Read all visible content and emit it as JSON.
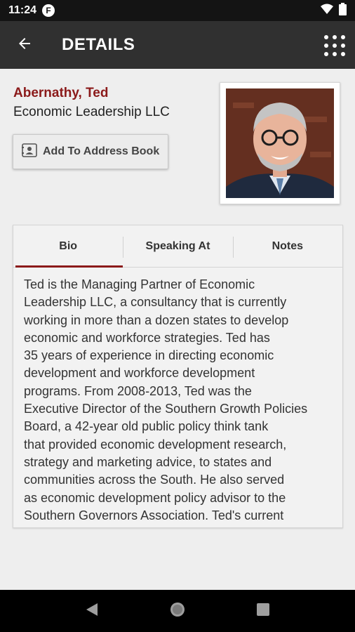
{
  "status_bar": {
    "time": "11:24",
    "badge": "F",
    "icons": [
      "wifi-icon",
      "battery-icon"
    ]
  },
  "app_bar": {
    "back_icon": "arrow-left-icon",
    "title": "DETAILS",
    "menu_icon": "grid-menu-icon"
  },
  "profile": {
    "name": "Abernathy, Ted",
    "company": "Economic Leadership LLC",
    "add_button_label": "Add To Address Book",
    "add_button_icon": "contact-card-icon",
    "accent_color": "#8b1a1a"
  },
  "tabs": [
    {
      "label": "Bio",
      "active": true
    },
    {
      "label": "Speaking At",
      "active": false
    },
    {
      "label": "Notes",
      "active": false
    }
  ],
  "bio": {
    "lines": [
      "Ted is the Managing Partner of Economic",
      "Leadership LLC, a consultancy that is currently",
      "working in more than a dozen states to develop",
      "economic and workforce strategies. Ted has",
      "35 years of experience in directing economic",
      "development and workforce development",
      "programs. From 2008-2013, Ted was the",
      "Executive Director of the Southern Growth Policies",
      "Board, a 42-year old public policy think tank",
      "that provided economic development research,",
      "strategy and marketing advice, to states and",
      "communities across the South. He also served",
      "as economic development policy advisor to the",
      "Southern Governors Association. Ted's current"
    ]
  },
  "nav_bar": {
    "items": [
      "back-triangle-icon",
      "home-circle-icon",
      "recents-square-icon"
    ]
  }
}
